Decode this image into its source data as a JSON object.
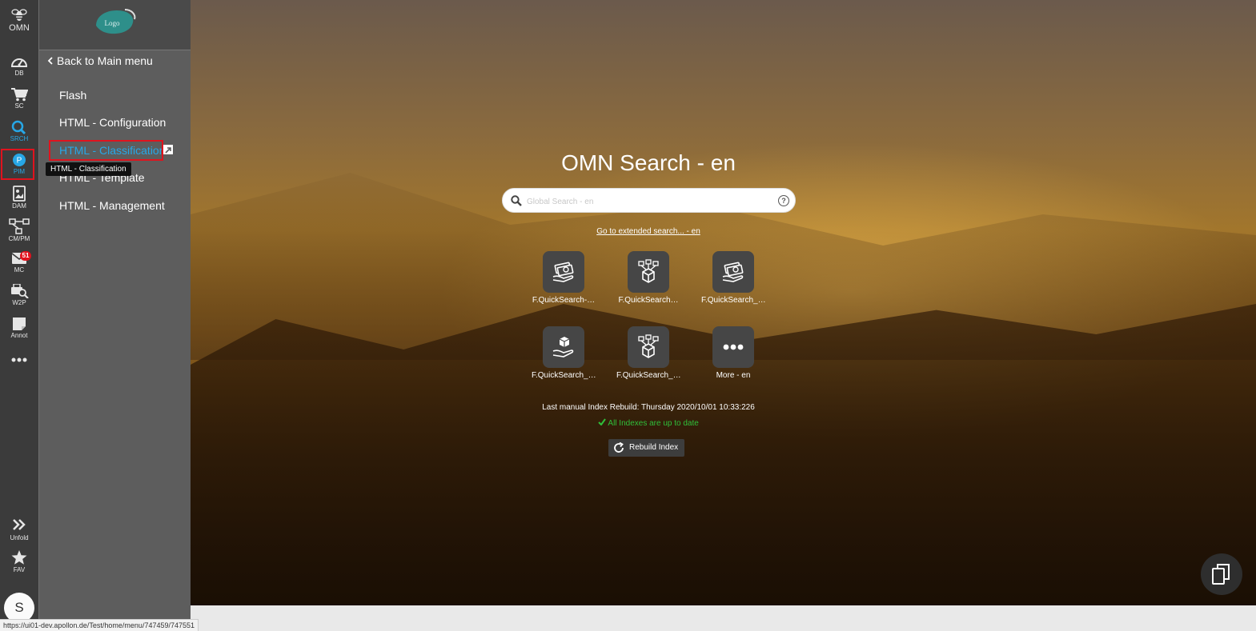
{
  "rail": {
    "brand": "OMN",
    "items": [
      {
        "label": "DB"
      },
      {
        "label": "SC"
      },
      {
        "label": "SRCH"
      },
      {
        "label": "PIM"
      },
      {
        "label": "DAM"
      },
      {
        "label": "CM/PM"
      },
      {
        "label": "MC",
        "badge": "51"
      },
      {
        "label": "W2P"
      },
      {
        "label": "Annot"
      }
    ],
    "unfold": "Unfold",
    "fav": "FAV",
    "avatar": "S",
    "accent": "#27a7e6",
    "highlight": "#e0131e"
  },
  "panel": {
    "logo_text": "Logo",
    "back_label": "Back to Main menu",
    "items": [
      {
        "label": "Flash"
      },
      {
        "label": "HTML - Configuration"
      },
      {
        "label": "HTML - Classification"
      },
      {
        "label": "HTML - Template"
      },
      {
        "label": "HTML - Management"
      }
    ],
    "tooltip": "HTML - Classification"
  },
  "main": {
    "title": "OMN Search - en",
    "search_placeholder": "Global Search - en",
    "help_glyph": "?",
    "extended_link": "Go to extended search... - en",
    "tiles": [
      {
        "caption": "F.QuickSearch-…",
        "icon": "money-hand-icon"
      },
      {
        "caption": "F.QuickSearch…",
        "icon": "product-tree-icon"
      },
      {
        "caption": "F.QuickSearch_…",
        "icon": "money-hand-icon"
      },
      {
        "caption": "F.QuickSearch_…",
        "icon": "box-hand-icon"
      },
      {
        "caption": "F.QuickSearch_…",
        "icon": "product-tree-icon"
      },
      {
        "caption": "More - en",
        "icon": "more-dots-icon"
      }
    ],
    "rebuild_info": "Last manual Index Rebuild: Thursday 2020/10/01 10:33:226",
    "up_to_date": "All Indexes are up to date",
    "rebuild_button": "Rebuild Index"
  },
  "statusbar": {
    "url": "https://ui01-dev.apollon.de/Test/home/menu/747459/747551"
  }
}
